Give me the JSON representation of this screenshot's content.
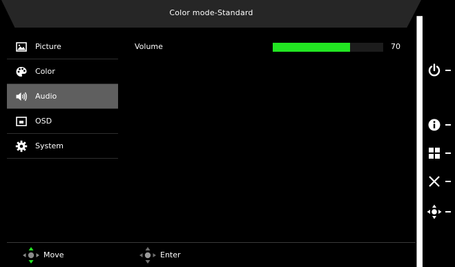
{
  "header": {
    "title": "Color mode-Standard"
  },
  "menu": {
    "items": [
      {
        "label": "Picture",
        "icon": "picture-icon",
        "active": false
      },
      {
        "label": "Color",
        "icon": "palette-icon",
        "active": false
      },
      {
        "label": "Audio",
        "icon": "speaker-icon",
        "active": true
      },
      {
        "label": "OSD",
        "icon": "osd-window-icon",
        "active": false
      },
      {
        "label": "System",
        "icon": "gear-icon",
        "active": false
      }
    ]
  },
  "content": {
    "setting_label": "Volume",
    "volume_value": "70",
    "volume_fraction": 0.7
  },
  "footer": {
    "move_label": "Move",
    "enter_label": "Enter"
  },
  "side_buttons": [
    "power-icon",
    "info-icon",
    "menu-grid-icon",
    "close-icon",
    "navigate-icon"
  ],
  "colors": {
    "osd_background": "#000000",
    "active_item": "#5f5f5f",
    "volume_bar": "#22e622",
    "move_arrow": "#22e622",
    "inactive_arrow": "#8a8a8a"
  }
}
